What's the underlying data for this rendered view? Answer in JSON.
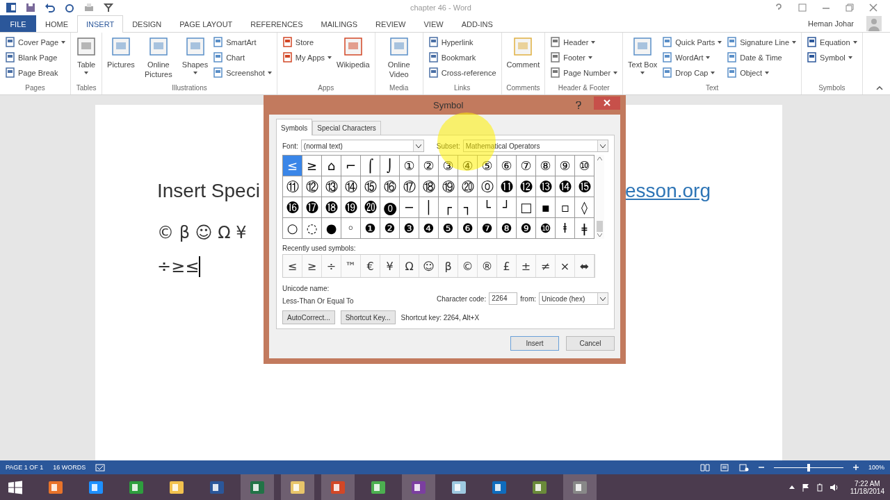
{
  "window": {
    "title": "chapter 46 - Word",
    "user": "Heman Johar"
  },
  "ribbon_tabs": [
    {
      "label": "FILE",
      "kind": "file",
      "selected": false
    },
    {
      "label": "HOME",
      "kind": "tab",
      "selected": false
    },
    {
      "label": "INSERT",
      "kind": "tab",
      "selected": true
    },
    {
      "label": "DESIGN",
      "kind": "tab",
      "selected": false
    },
    {
      "label": "PAGE LAYOUT",
      "kind": "tab",
      "selected": false
    },
    {
      "label": "REFERENCES",
      "kind": "tab",
      "selected": false
    },
    {
      "label": "MAILINGS",
      "kind": "tab",
      "selected": false
    },
    {
      "label": "REVIEW",
      "kind": "tab",
      "selected": false
    },
    {
      "label": "VIEW",
      "kind": "tab",
      "selected": false
    },
    {
      "label": "ADD-INS",
      "kind": "tab",
      "selected": false
    }
  ],
  "ribbon_groups": [
    {
      "label": "Pages",
      "columns": [
        [
          {
            "label": "Cover Page",
            "kind": "small",
            "dropdown": true
          },
          {
            "label": "Blank Page",
            "kind": "small",
            "dropdown": false
          },
          {
            "label": "Page Break",
            "kind": "small",
            "dropdown": false
          }
        ]
      ]
    },
    {
      "label": "Tables",
      "columns": [
        [
          {
            "label": "Table",
            "kind": "large",
            "dropdown": true
          }
        ]
      ]
    },
    {
      "label": "Illustrations",
      "columns": [
        [
          {
            "label": "Pictures",
            "kind": "large",
            "dropdown": false
          }
        ],
        [
          {
            "label": "Online Pictures",
            "kind": "large",
            "dropdown": false
          }
        ],
        [
          {
            "label": "Shapes",
            "kind": "large",
            "dropdown": true
          }
        ],
        [
          {
            "label": "SmartArt",
            "kind": "small",
            "dropdown": false
          },
          {
            "label": "Chart",
            "kind": "small",
            "dropdown": false
          },
          {
            "label": "Screenshot",
            "kind": "small",
            "dropdown": true
          }
        ]
      ]
    },
    {
      "label": "Apps",
      "columns": [
        [
          {
            "label": "Store",
            "kind": "small",
            "dropdown": false
          },
          {
            "label": "My Apps",
            "kind": "small",
            "dropdown": true
          }
        ],
        [
          {
            "label": "Wikipedia",
            "kind": "large",
            "dropdown": false
          }
        ]
      ]
    },
    {
      "label": "Media",
      "columns": [
        [
          {
            "label": "Online Video",
            "kind": "large",
            "dropdown": false
          }
        ]
      ]
    },
    {
      "label": "Links",
      "columns": [
        [
          {
            "label": "Hyperlink",
            "kind": "small",
            "dropdown": false
          },
          {
            "label": "Bookmark",
            "kind": "small",
            "dropdown": false
          },
          {
            "label": "Cross-reference",
            "kind": "small",
            "dropdown": false
          }
        ]
      ]
    },
    {
      "label": "Comments",
      "columns": [
        [
          {
            "label": "Comment",
            "kind": "large",
            "dropdown": false
          }
        ]
      ]
    },
    {
      "label": "Header & Footer",
      "columns": [
        [
          {
            "label": "Header",
            "kind": "small",
            "dropdown": true
          },
          {
            "label": "Footer",
            "kind": "small",
            "dropdown": true
          },
          {
            "label": "Page Number",
            "kind": "small",
            "dropdown": true
          }
        ]
      ]
    },
    {
      "label": "Text",
      "columns": [
        [
          {
            "label": "Text Box",
            "kind": "large",
            "dropdown": true
          }
        ],
        [
          {
            "label": "Quick Parts",
            "kind": "small",
            "dropdown": true
          },
          {
            "label": "WordArt",
            "kind": "small",
            "dropdown": true
          },
          {
            "label": "Drop Cap",
            "kind": "small",
            "dropdown": true
          }
        ],
        [
          {
            "label": "Signature Line",
            "kind": "small",
            "dropdown": true
          },
          {
            "label": "Date & Time",
            "kind": "small",
            "dropdown": false
          },
          {
            "label": "Object",
            "kind": "small",
            "dropdown": true
          }
        ]
      ]
    },
    {
      "label": "Symbols",
      "columns": [
        [
          {
            "label": "Equation",
            "kind": "small",
            "dropdown": true
          },
          {
            "label": "Symbol",
            "kind": "small",
            "dropdown": true
          }
        ]
      ]
    }
  ],
  "document": {
    "heading_left": "Insert Speci",
    "heading_link": "esson.org",
    "symbols_line": "© β ☺ Ω ¥",
    "typed_line": "÷≥≤"
  },
  "dialog": {
    "title": "Symbol",
    "tabs": [
      {
        "label": "Symbols",
        "selected": true
      },
      {
        "label": "Special Characters",
        "selected": false
      }
    ],
    "font": {
      "label": "Font:",
      "value": "(normal text)"
    },
    "subset": {
      "label": "Subset:",
      "value": "Mathematical Operators"
    },
    "symbols": [
      {
        "char": "≤",
        "selected": true
      },
      {
        "char": "≥",
        "selected": false
      },
      {
        "char": "⌂",
        "selected": false
      },
      {
        "char": "⌐",
        "selected": false
      },
      {
        "char": "⌠",
        "selected": false
      },
      {
        "char": "⌡",
        "selected": false
      },
      {
        "char": "①",
        "selected": false
      },
      {
        "char": "②",
        "selected": false
      },
      {
        "char": "③",
        "selected": false
      },
      {
        "char": "④",
        "selected": false
      },
      {
        "char": "⑤",
        "selected": false
      },
      {
        "char": "⑥",
        "selected": false
      },
      {
        "char": "⑦",
        "selected": false
      },
      {
        "char": "⑧",
        "selected": false
      },
      {
        "char": "⑨",
        "selected": false
      },
      {
        "char": "⑩",
        "selected": false
      },
      {
        "char": "⑪",
        "selected": false
      },
      {
        "char": "⑫",
        "selected": false
      },
      {
        "char": "⑬",
        "selected": false
      },
      {
        "char": "⑭",
        "selected": false
      },
      {
        "char": "⑮",
        "selected": false
      },
      {
        "char": "⑯",
        "selected": false
      },
      {
        "char": "⑰",
        "selected": false
      },
      {
        "char": "⑱",
        "selected": false
      },
      {
        "char": "⑲",
        "selected": false
      },
      {
        "char": "⑳",
        "selected": false
      },
      {
        "char": "⓪",
        "selected": false
      },
      {
        "char": "⓫",
        "selected": false
      },
      {
        "char": "⓬",
        "selected": false
      },
      {
        "char": "⓭",
        "selected": false
      },
      {
        "char": "⓮",
        "selected": false
      },
      {
        "char": "⓯",
        "selected": false
      },
      {
        "char": "⓰",
        "selected": false
      },
      {
        "char": "⓱",
        "selected": false
      },
      {
        "char": "⓲",
        "selected": false
      },
      {
        "char": "⓳",
        "selected": false
      },
      {
        "char": "⓴",
        "selected": false
      },
      {
        "char": "⓿",
        "selected": false
      },
      {
        "char": "─",
        "selected": false
      },
      {
        "char": "│",
        "selected": false
      },
      {
        "char": "┌",
        "selected": false
      },
      {
        "char": "┐",
        "selected": false
      },
      {
        "char": "└",
        "selected": false
      },
      {
        "char": "┘",
        "selected": false
      },
      {
        "char": "□",
        "selected": false
      },
      {
        "char": "▪",
        "selected": false
      },
      {
        "char": "▫",
        "selected": false
      },
      {
        "char": "◊",
        "selected": false
      },
      {
        "char": "○",
        "selected": false
      },
      {
        "char": "◌",
        "selected": false
      },
      {
        "char": "●",
        "selected": false
      },
      {
        "char": "◦",
        "selected": false
      },
      {
        "char": "❶",
        "selected": false
      },
      {
        "char": "❷",
        "selected": false
      },
      {
        "char": "❸",
        "selected": false
      },
      {
        "char": "❹",
        "selected": false
      },
      {
        "char": "❺",
        "selected": false
      },
      {
        "char": "❻",
        "selected": false
      },
      {
        "char": "❼",
        "selected": false
      },
      {
        "char": "❽",
        "selected": false
      },
      {
        "char": "❾",
        "selected": false
      },
      {
        "char": "❿",
        "selected": false
      },
      {
        "char": "ⱡ",
        "selected": false
      },
      {
        "char": "ǂ",
        "selected": false
      }
    ],
    "recent_label": "Recently used symbols:",
    "recent": [
      "≤",
      "≥",
      "÷",
      "™",
      "€",
      "¥",
      "Ω",
      "☺",
      "β",
      "©",
      "®",
      "£",
      "±",
      "≠",
      "×",
      "⬌"
    ],
    "unicode_name_label": "Unicode name:",
    "unicode_name": "Less-Than Or Equal To",
    "char_code_label": "Character code:",
    "char_code": "2264",
    "from_label": "from:",
    "from_value": "Unicode (hex)",
    "tool_buttons": [
      "AutoCorrect...",
      "Shortcut Key..."
    ],
    "shortcut_text": "Shortcut key: 2264, Alt+X",
    "actions": [
      {
        "label": "Insert",
        "default": true
      },
      {
        "label": "Cancel",
        "default": false
      }
    ]
  },
  "status_bar": {
    "page": "PAGE 1 OF 1",
    "words": "16 WORDS",
    "zoom": {
      "level": 0.5
    },
    "zoom_text": "100%"
  },
  "taskbar": {
    "apps": [
      {
        "running": false
      },
      {
        "running": false
      },
      {
        "running": false
      },
      {
        "running": false
      },
      {
        "running": false
      },
      {
        "running": true
      },
      {
        "running": true
      },
      {
        "running": true
      },
      {
        "running": false
      },
      {
        "running": true
      },
      {
        "running": false
      },
      {
        "running": false
      },
      {
        "running": false
      },
      {
        "running": true
      }
    ],
    "time": "7:22 AM",
    "date": "11/18/2014"
  }
}
